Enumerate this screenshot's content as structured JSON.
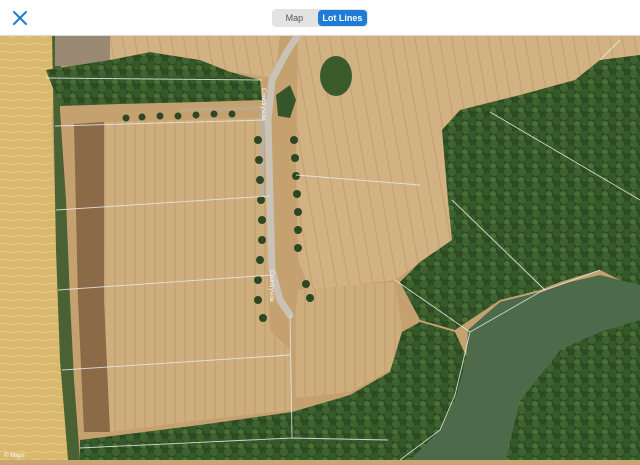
{
  "header": {
    "close_icon": "close-x-icon",
    "tabs": [
      {
        "label": "Map",
        "selected": false
      },
      {
        "label": "Lot Lines",
        "selected": true
      }
    ],
    "accent_color": "#1e7bd6"
  },
  "map": {
    "view": "satellite",
    "roads": [
      {
        "label": "Countryside"
      },
      {
        "label": "Countryside"
      }
    ],
    "credit": "© Maps"
  }
}
